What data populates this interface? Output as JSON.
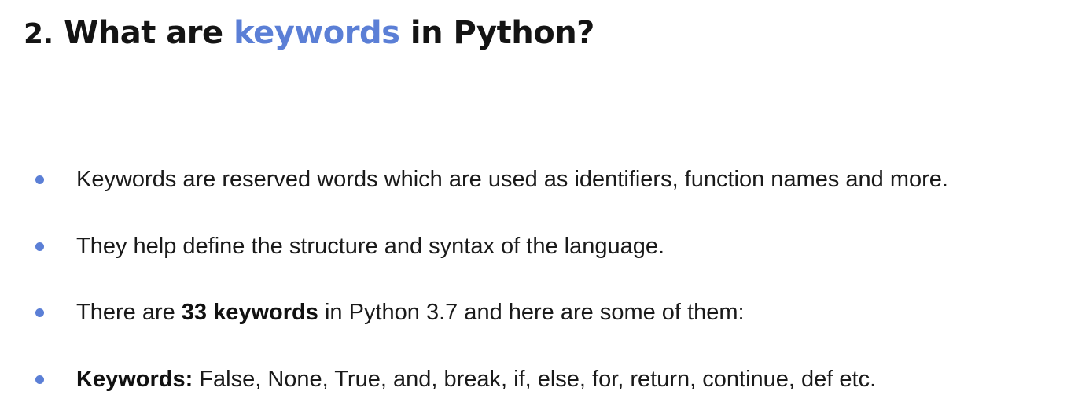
{
  "slide": {
    "title": {
      "number": "2.",
      "prefix": "What are",
      "highlight": "keywords",
      "suffix": "in Python?"
    },
    "bullets": [
      {
        "text": "Keywords are reserved words which are used as identifiers, function names and more."
      },
      {
        "text": "They help define the structure and syntax of the language."
      },
      {
        "lead": "There are",
        "bold": "33 keywords",
        "rest": "in Python 3.7 and here are some of them:"
      },
      {
        "bold": "Keywords:",
        "rest": "False, None, True, and, break, if, else, for, return, continue, def etc."
      }
    ]
  },
  "colors": {
    "accent": "#5b7fd6",
    "text": "#1a1a1a",
    "background": "#ffffff"
  }
}
